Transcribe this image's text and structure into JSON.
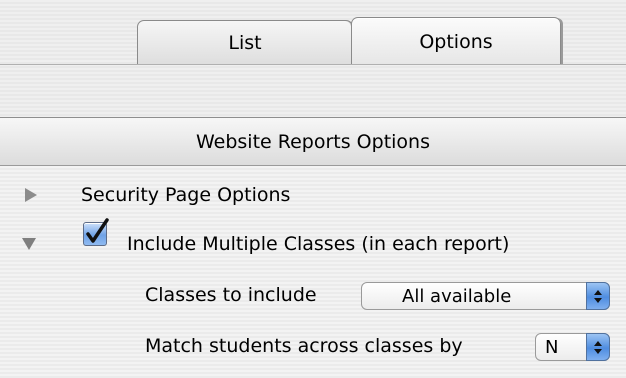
{
  "tabs": [
    {
      "label": "List",
      "selected": false
    },
    {
      "label": "Options",
      "selected": true
    }
  ],
  "panel": {
    "title": "Website Reports Options",
    "security_group": {
      "label": "Security Page Options",
      "expanded": false
    },
    "multiple_classes": {
      "label": "Include Multiple Classes (in each report)",
      "checked": true,
      "expanded": true,
      "classes_to_include": {
        "label": "Classes to include",
        "value": "All available"
      },
      "match_students": {
        "label": "Match students across classes by",
        "value": "N"
      }
    }
  },
  "colors": {
    "accent": "#4f8de0",
    "background": "#ececec"
  }
}
